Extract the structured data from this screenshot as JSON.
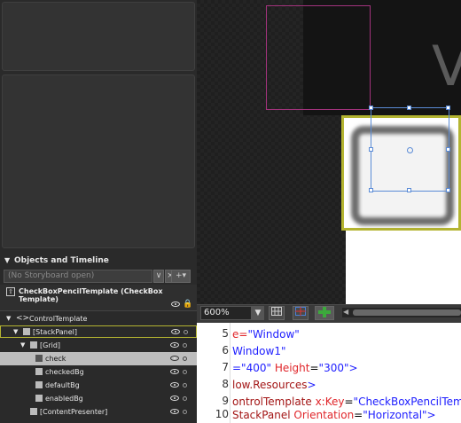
{
  "objects_panel": {
    "header": "Objects and Timeline",
    "storyboard_placeholder": "(No Storyboard open)",
    "storyboard_btn": "∨",
    "close_btn": "×",
    "add_btn": "+",
    "template_title": "CheckBoxPencilTemplate (CheckBox Template)",
    "tree": [
      {
        "label": "ControlTemplate"
      },
      {
        "label": "[StackPanel]"
      },
      {
        "label": "[Grid]"
      },
      {
        "label": "check"
      },
      {
        "label": "checkedBg"
      },
      {
        "label": "defaultBg"
      },
      {
        "label": "enabledBg"
      },
      {
        "label": "[ContentPresenter]"
      }
    ]
  },
  "design_view": {
    "big_letter": "V",
    "zoom_value": "600%",
    "zoom_arrow": "▼"
  },
  "code_editor": {
    "lines": [
      {
        "num": "5",
        "parts": [
          {
            "t": "e=",
            "c": "c-red"
          },
          {
            "t": "\"Window\"",
            "c": "c-blue"
          }
        ]
      },
      {
        "num": "6",
        "parts": [
          {
            "t": " Window1\"",
            "c": "c-blue"
          }
        ]
      },
      {
        "num": "7",
        "parts": [
          {
            "t": "=\"400\"",
            "c": "c-blue"
          },
          {
            "t": " Height",
            "c": "c-red"
          },
          {
            "t": "=",
            "c": "c-black"
          },
          {
            "t": "\"300\"",
            "c": "c-blue"
          },
          {
            "t": ">",
            "c": "c-blue"
          }
        ]
      },
      {
        "num": "8",
        "parts": [
          {
            "t": "low.Resources",
            "c": "c-brown"
          },
          {
            "t": ">",
            "c": "c-blue"
          }
        ]
      },
      {
        "num": "9",
        "parts": [
          {
            "t": "ontrolTemplate",
            "c": "c-brown"
          },
          {
            "t": " x:Key",
            "c": "c-red"
          },
          {
            "t": "=",
            "c": "c-black"
          },
          {
            "t": "\"CheckBoxPencilTemp",
            "c": "c-blue"
          }
        ]
      },
      {
        "num": "10",
        "parts": [
          {
            "t": "StackPanel",
            "c": "c-brown"
          },
          {
            "t": " Orientation",
            "c": "c-red"
          },
          {
            "t": "=",
            "c": "c-black"
          },
          {
            "t": "\"Horizontal\"",
            "c": "c-blue"
          },
          {
            "t": ">",
            "c": "c-blue"
          }
        ]
      }
    ]
  }
}
